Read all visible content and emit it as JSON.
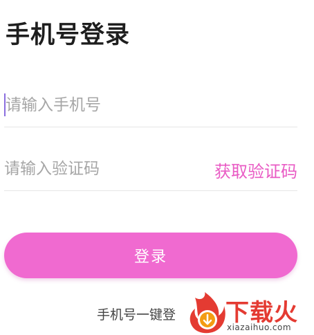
{
  "page": {
    "title": "手机号登录"
  },
  "form": {
    "phone": {
      "value": "",
      "placeholder": "请输入手机号"
    },
    "code": {
      "value": "",
      "placeholder": "请输入验证码",
      "get_code_label": "获取验证码"
    },
    "login_label": "登录",
    "one_key_login_label": "手机号一键登"
  },
  "watermark": {
    "name": "下载火",
    "url": "xiazaihuo.com"
  },
  "colors": {
    "accent": "#f06ad0",
    "link": "#e95bc4",
    "title": "#1e1e1e",
    "placeholder": "#a6a6a6",
    "caret": "#8a6ddf",
    "watermark_red": "#e43b32"
  },
  "icons": {
    "watermark_logo": "flame-icon"
  }
}
